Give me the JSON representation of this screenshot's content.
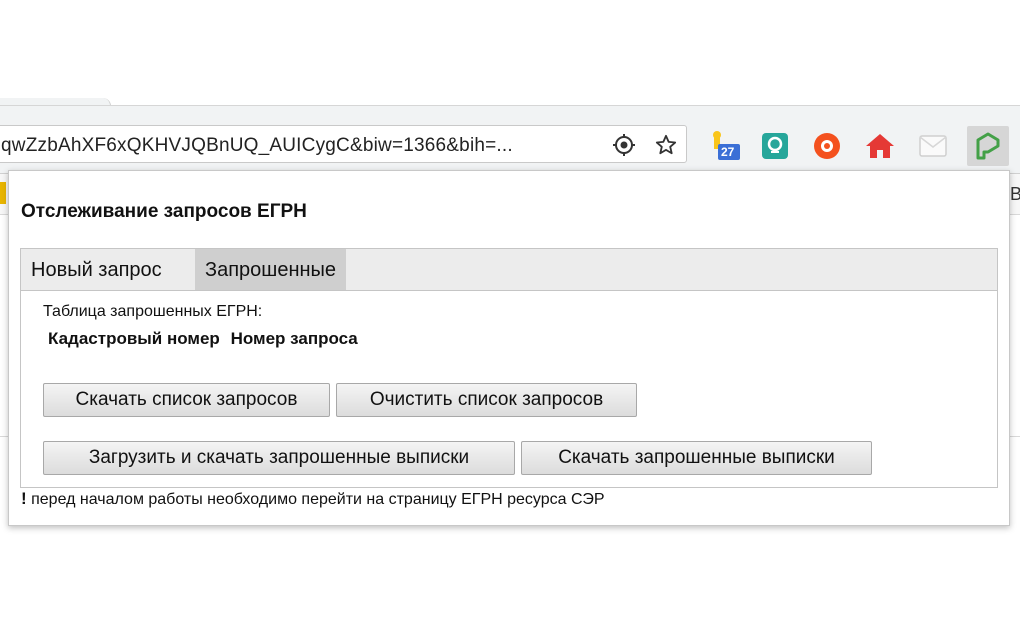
{
  "browser": {
    "url": "qwZzbAhXF6xQKHVJQBnUQ_AUICygC&biw=1366&bih=...",
    "extension_badge": "27",
    "page_right_text": "Вд"
  },
  "popup": {
    "title": "Отслеживание запросов ЕГРН",
    "tabs": [
      {
        "label": "Новый запрос",
        "active": false
      },
      {
        "label": "Запрошенные",
        "active": true
      }
    ],
    "table_caption": "Таблица запрошенных ЕГРН:",
    "table_headers": [
      "Кадастровый номер",
      "Номер запроса"
    ],
    "buttons": {
      "download_list": "Скачать список запросов",
      "clear_list": "Очистить список запросов",
      "load_and_download": "Загрузить и скачать запрошенные выписки",
      "download_extracts": "Скачать запрошенные выписки"
    },
    "note_mark": "!",
    "note_text": " перед началом работы необходимо перейти на страницу ЕГРН ресурса СЭР"
  },
  "icons": {
    "target": "target-icon",
    "star": "star-icon",
    "ext1": "notification-extension-icon",
    "ext2": "map-pin-extension-icon",
    "ext3": "shield-extension-icon",
    "ext4": "home-extension-icon",
    "ext5": "mail-extension-icon",
    "ext6": "egrn-extension-icon"
  },
  "colors": {
    "active_tab": "#cfcfcf",
    "tab_bar": "#ececec",
    "home_icon": "#e53935",
    "shield_icon": "#f4511e",
    "pin_icon": "#26a69a",
    "egrn_icon": "#43a047"
  }
}
